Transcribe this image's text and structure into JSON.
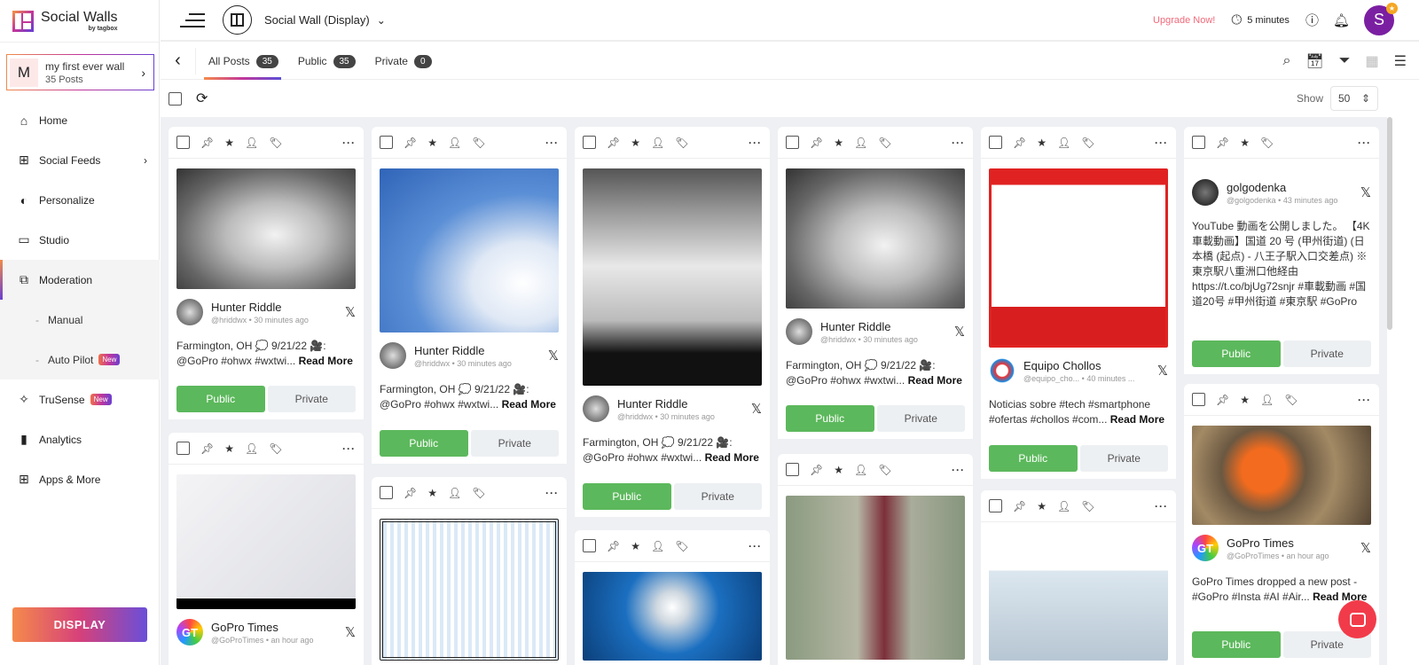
{
  "app": {
    "name": "Social Walls",
    "by": "by tagbox"
  },
  "wall": {
    "initial": "M",
    "name": "my first ever wall",
    "posts": "35 Posts"
  },
  "nav": [
    {
      "label": "Home",
      "icon": "home-icon"
    },
    {
      "label": "Social Feeds",
      "icon": "plus-square-icon"
    },
    {
      "label": "Personalize",
      "icon": "drop-icon"
    },
    {
      "label": "Studio",
      "icon": "monitor-icon"
    },
    {
      "label": "Moderation",
      "icon": "moderation-icon",
      "active": true
    },
    {
      "label": "TruSense",
      "icon": "sparkle-icon",
      "badge": "New"
    },
    {
      "label": "Analytics",
      "icon": "bar-chart-icon"
    },
    {
      "label": "Apps & More",
      "icon": "apps-icon"
    }
  ],
  "moderation_sub": [
    {
      "label": "Manual"
    },
    {
      "label": "Auto Pilot",
      "badge": "New"
    }
  ],
  "display_button": "DISPLAY",
  "topbar": {
    "wall_title": "Social Wall (Display)",
    "upgrade": "Upgrade Now!",
    "timer": "5 minutes",
    "avatar": "S"
  },
  "tabs": [
    {
      "label": "All Posts",
      "count": "35",
      "active": true
    },
    {
      "label": "Public",
      "count": "35"
    },
    {
      "label": "Private",
      "count": "0"
    }
  ],
  "show": {
    "label": "Show",
    "value": "50"
  },
  "buttons": {
    "public": "Public",
    "private": "Private",
    "read_more": "Read More"
  },
  "colors": {
    "accent": "#c2369a",
    "public": "#5cb85c",
    "upgrade": "#f06a7a",
    "avatar": "#7b1fa2"
  },
  "posts": [
    {
      "author": "Hunter Riddle",
      "meta": "@hriddwx • 30 minutes ago",
      "text": "Farmington, OH 💭 9/21/22 🎥: @GoPro #ohwx #wxtwi...",
      "network": "x-icon"
    },
    {
      "author": "GoPro Times",
      "meta": "@GoProTimes • an hour ago",
      "network": "x-icon"
    },
    {
      "author": "Hunter Riddle",
      "meta": "@hriddwx • 30 minutes ago",
      "text": "Farmington, OH 💭 9/21/22 🎥: @GoPro #ohwx #wxtwi...",
      "network": "x-icon"
    },
    {},
    {
      "author": "Hunter Riddle",
      "meta": "@hriddwx • 30 minutes ago",
      "text": "Farmington, OH 💭 9/21/22 🎥: @GoPro #ohwx #wxtwi...",
      "network": "x-icon"
    },
    {},
    {
      "author": "Hunter Riddle",
      "meta": "@hriddwx • 30 minutes ago",
      "text": "Farmington, OH 💭 9/21/22 🎥: @GoPro #ohwx #wxtwi...",
      "network": "x-icon"
    },
    {},
    {
      "author": "Equipo Chollos",
      "meta": "@equipo_cho... • 40 minutes ...",
      "text": "Noticias sobre #tech #smartphone #ofertas #chollos #com...",
      "network": "x-icon"
    },
    {},
    {
      "author": "golgodenka",
      "meta": "@golgodenka • 43 minutes ago",
      "text": "YouTube 動画を公開しました。 【4K車載動画】国道 20 号 (甲州街道) (日本橋 (起点) - 八王子駅入口交差点) ※東京駅八重洲口他経由 https://t.co/bjUg72snjr #車載動画 #国道20号 #甲州街道 #東京駅 #GoPro",
      "network": "x-icon"
    },
    {
      "author": "GoPro Times",
      "meta": "@GoProTimes • an hour ago",
      "text": "GoPro Times dropped a new post - #GoPro #Insta #AI #Air...",
      "network": "x-icon"
    }
  ]
}
